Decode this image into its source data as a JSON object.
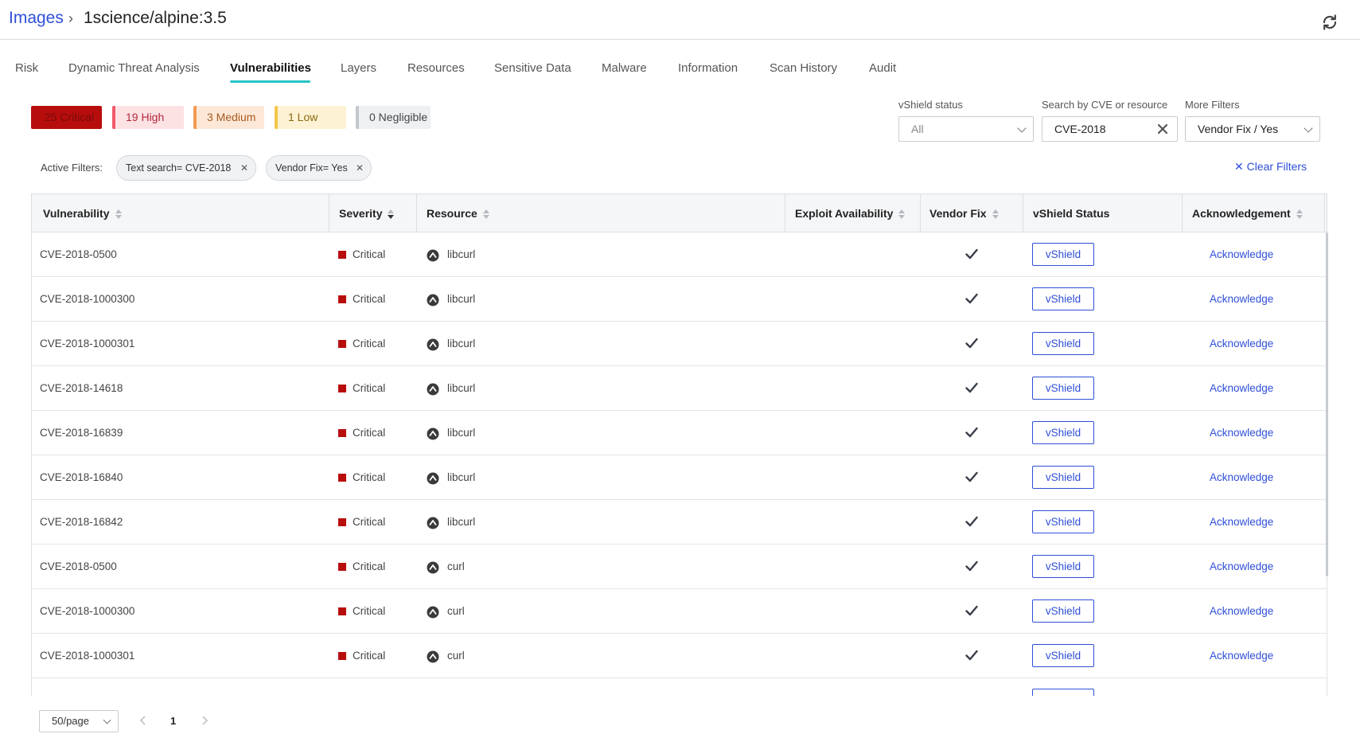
{
  "breadcrumb": {
    "root": "Images",
    "separator": "›",
    "current": "1science/alpine:3.5"
  },
  "tabs": [
    {
      "label": "Risk"
    },
    {
      "label": "Dynamic Threat Analysis"
    },
    {
      "label": "Vulnerabilities",
      "active": true
    },
    {
      "label": "Layers"
    },
    {
      "label": "Resources"
    },
    {
      "label": "Sensitive Data"
    },
    {
      "label": "Malware"
    },
    {
      "label": "Information"
    },
    {
      "label": "Scan History"
    },
    {
      "label": "Audit"
    }
  ],
  "severity_chips": [
    {
      "label": "25 Critical",
      "color": "#b80d0d"
    },
    {
      "label": "19 High",
      "color": "#f05a6b"
    },
    {
      "label": "3 Medium",
      "color": "#f39a52"
    },
    {
      "label": "1 Low",
      "color": "#f6c64a"
    },
    {
      "label": "0 Negligible",
      "color": "#c4c7cc"
    }
  ],
  "filters": {
    "vshield_status": {
      "label": "vShield status",
      "value": "All"
    },
    "search": {
      "label": "Search by CVE or resource",
      "value": "CVE-2018"
    },
    "more": {
      "label": "More Filters",
      "value": "Vendor Fix / Yes"
    }
  },
  "active_filters": {
    "label": "Active Filters:",
    "pills": [
      "Text search= CVE-2018",
      "Vendor Fix= Yes"
    ],
    "clear_label": "Clear Filters"
  },
  "table": {
    "columns": [
      "Vulnerability",
      "Severity",
      "Resource",
      "Exploit Availability",
      "Vendor Fix",
      "vShield Status",
      "Acknowledgement"
    ],
    "rows": [
      {
        "vulnerability": "CVE-2018-0500",
        "severity": "Critical",
        "resource": "libcurl",
        "vendor_fix": true,
        "vshield": "vShield",
        "acknowledge": "Acknowledge"
      },
      {
        "vulnerability": "CVE-2018-1000300",
        "severity": "Critical",
        "resource": "libcurl",
        "vendor_fix": true,
        "vshield": "vShield",
        "acknowledge": "Acknowledge"
      },
      {
        "vulnerability": "CVE-2018-1000301",
        "severity": "Critical",
        "resource": "libcurl",
        "vendor_fix": true,
        "vshield": "vShield",
        "acknowledge": "Acknowledge"
      },
      {
        "vulnerability": "CVE-2018-14618",
        "severity": "Critical",
        "resource": "libcurl",
        "vendor_fix": true,
        "vshield": "vShield",
        "acknowledge": "Acknowledge"
      },
      {
        "vulnerability": "CVE-2018-16839",
        "severity": "Critical",
        "resource": "libcurl",
        "vendor_fix": true,
        "vshield": "vShield",
        "acknowledge": "Acknowledge"
      },
      {
        "vulnerability": "CVE-2018-16840",
        "severity": "Critical",
        "resource": "libcurl",
        "vendor_fix": true,
        "vshield": "vShield",
        "acknowledge": "Acknowledge"
      },
      {
        "vulnerability": "CVE-2018-16842",
        "severity": "Critical",
        "resource": "libcurl",
        "vendor_fix": true,
        "vshield": "vShield",
        "acknowledge": "Acknowledge"
      },
      {
        "vulnerability": "CVE-2018-0500",
        "severity": "Critical",
        "resource": "curl",
        "vendor_fix": true,
        "vshield": "vShield",
        "acknowledge": "Acknowledge"
      },
      {
        "vulnerability": "CVE-2018-1000300",
        "severity": "Critical",
        "resource": "curl",
        "vendor_fix": true,
        "vshield": "vShield",
        "acknowledge": "Acknowledge"
      },
      {
        "vulnerability": "CVE-2018-1000301",
        "severity": "Critical",
        "resource": "curl",
        "vendor_fix": true,
        "vshield": "vShield",
        "acknowledge": "Acknowledge"
      }
    ]
  },
  "pagination": {
    "page_size": "50/page",
    "current_page": "1"
  },
  "colors": {
    "accent": "#2f4fd8",
    "tab_underline": "#27c4c7",
    "critical": "#b80d0d"
  }
}
